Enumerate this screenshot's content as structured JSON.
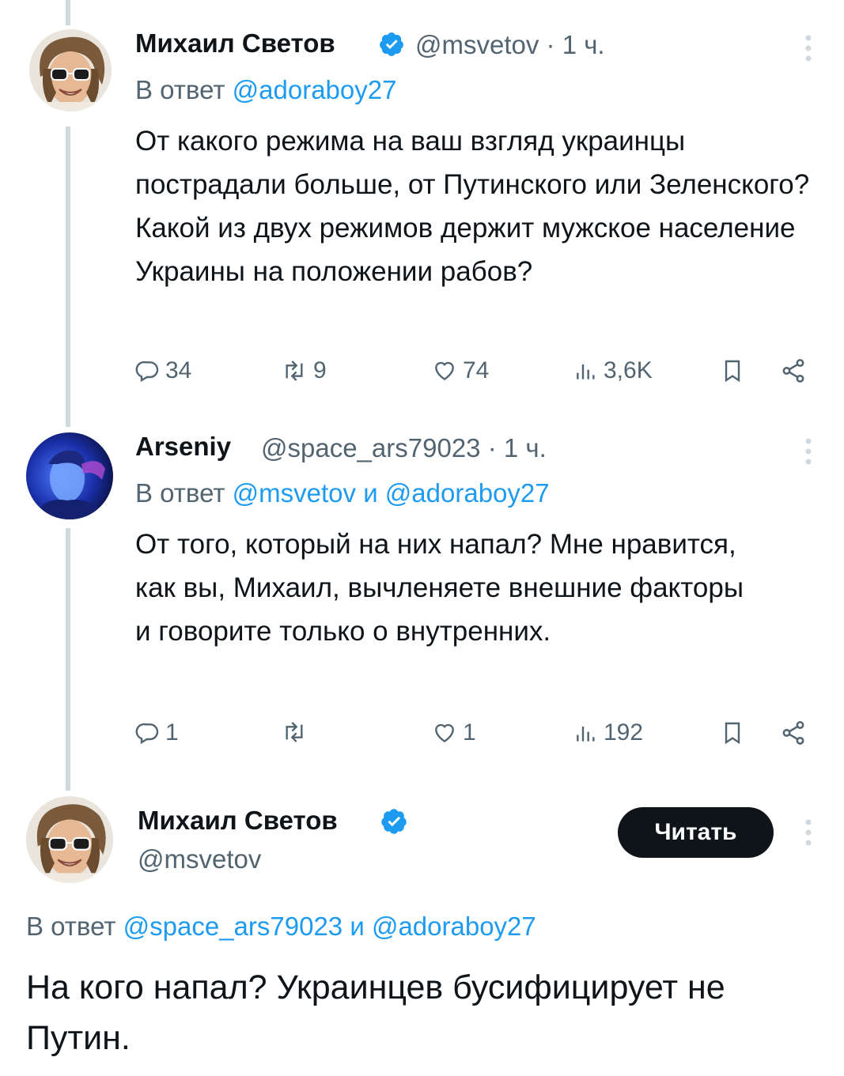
{
  "tweet1": {
    "author_name": "Михаил Светов",
    "handle": "@msvetov",
    "time": "· 1 ч.",
    "reply_prefix": "В ответ",
    "reply_to_1": "@adoraboy27",
    "text": "От какого режима на ваш взгляд украинцы пострадали больше, от Путинского или Зеленского? Какой из двух режимов держит мужское население Украины на положении рабов?",
    "replies": "34",
    "retweets": "9",
    "likes": "74",
    "views": "3,6K"
  },
  "tweet2": {
    "author_name": "Arseniy",
    "handle": "@space_ars79023",
    "time": "· 1 ч.",
    "reply_prefix": "В ответ",
    "reply_to_1": "@msvetov",
    "reply_and": "и",
    "reply_to_2": "@adoraboy27",
    "text": "От того, который на них напал? Мне нравится, как вы, Михаил, вычленяете внешние факторы и говорите только о внутренних.",
    "replies": "1",
    "retweets": "",
    "likes": "1",
    "views": "192"
  },
  "tweet3": {
    "author_name": "Михаил Светов",
    "handle": "@msvetov",
    "follow_label": "Читать",
    "reply_prefix": "В ответ",
    "reply_to_1": "@space_ars79023",
    "reply_and": "и",
    "reply_to_2": "@adoraboy27",
    "text": "На кого напал? Украинцев бусифицирует не Путин."
  },
  "colors": {
    "accent": "#1d9bf0",
    "secondary_text": "#536471",
    "primary_text": "#0f1419",
    "thread_line": "#cfd9de"
  },
  "icons": [
    "verified-badge-icon",
    "more-options-icon",
    "reply-icon",
    "retweet-icon",
    "like-icon",
    "views-icon",
    "bookmark-icon",
    "share-icon"
  ]
}
